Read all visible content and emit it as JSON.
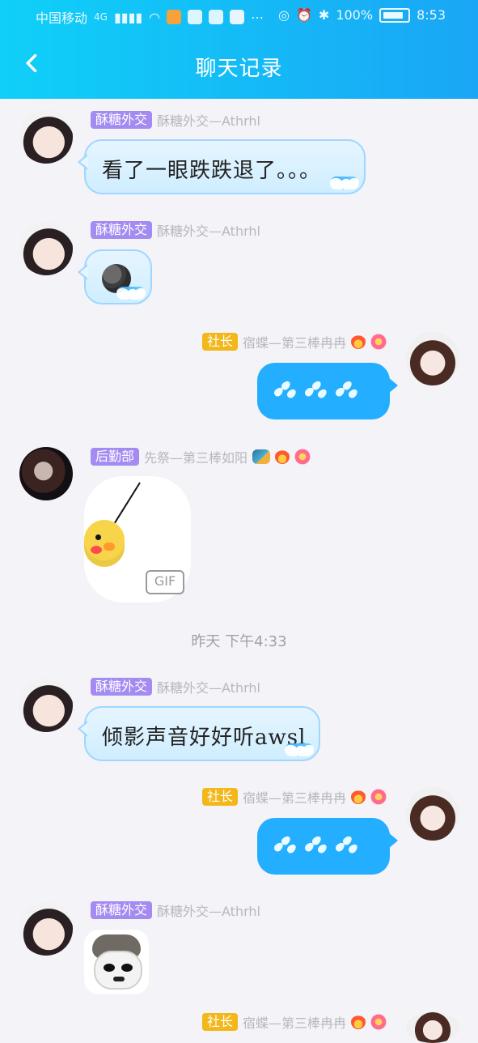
{
  "status_bar": {
    "carrier": "中国移动",
    "network": "4G",
    "time": "8:53",
    "battery": "100%"
  },
  "header": {
    "title": "聊天记录"
  },
  "messages": [
    {
      "tag": "酥糖外交",
      "name": "酥糖外交—Athrhl",
      "text": "看了一眼跌跌退了。。。"
    },
    {
      "tag": "酥糖外交",
      "name": "酥糖外交—Athrhl",
      "emoji": "moon-face"
    },
    {
      "tag": "社长",
      "name": "宿蝶—第三棒冉冉",
      "emoji": "sweat-drops"
    },
    {
      "tag": "后勤部",
      "name": "先祭—第三棒如阳",
      "sticker_label": "GIF"
    }
  ],
  "time_divider": "昨天 下午4:33",
  "messages2": [
    {
      "tag": "酥糖外交",
      "name": "酥糖外交—Athrhl",
      "text": "倾影声音好好听awsl"
    },
    {
      "tag": "社长",
      "name": "宿蝶—第三棒冉冉",
      "emoji": "sweat-drops"
    },
    {
      "tag": "酥糖外交",
      "name": "酥糖外交—Athrhl",
      "sticker": "meme-face"
    },
    {
      "tag": "社长",
      "name": "宿蝶—第三棒冉冉"
    }
  ],
  "colors": {
    "header_left": "#0fd0f8",
    "header_right": "#1aa6f5",
    "right_bubble": "#23aeff",
    "left_bubble_border": "#9fd6ff",
    "tag_purple": "#a48bf2",
    "tag_orange": "#f3b71a",
    "page_bg": "#f3f3f8"
  },
  "icons": {
    "back": "chevron-left-icon",
    "fire": "fire-icon",
    "flower": "flower-icon",
    "dragon": "dragon-icon"
  }
}
